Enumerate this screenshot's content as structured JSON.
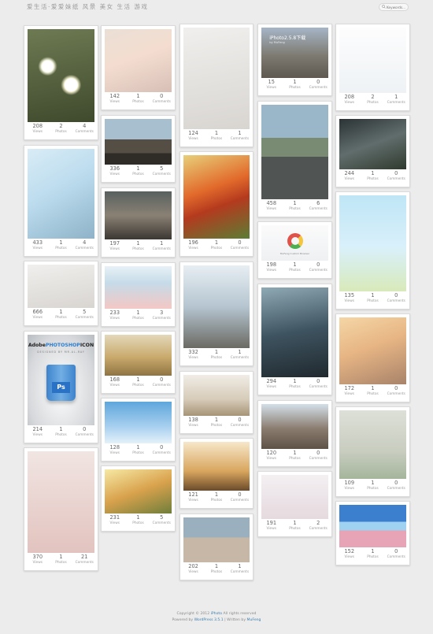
{
  "header": {
    "logo_text": "爱生活·爱爱妹纸 风景 美女 生活 游戏",
    "search_placeholder": "Keywords..."
  },
  "labels": {
    "views": "Views",
    "photos": "Photos",
    "comments": "Comments"
  },
  "cards": [
    {
      "views": "208",
      "photos": "2",
      "comments": "4"
    },
    {
      "views": "433",
      "photos": "1",
      "comments": "4"
    },
    {
      "views": "666",
      "photos": "1",
      "comments": "5"
    },
    {
      "views": "214",
      "photos": "1",
      "comments": "0"
    },
    {
      "views": "370",
      "photos": "1",
      "comments": "21"
    },
    {
      "views": "142",
      "photos": "1",
      "comments": "0"
    },
    {
      "views": "336",
      "photos": "1",
      "comments": "5"
    },
    {
      "views": "197",
      "photos": "1",
      "comments": "1"
    },
    {
      "views": "233",
      "photos": "1",
      "comments": "3"
    },
    {
      "views": "168",
      "photos": "1",
      "comments": "0"
    },
    {
      "views": "128",
      "photos": "1",
      "comments": "0"
    },
    {
      "views": "231",
      "photos": "1",
      "comments": "5"
    },
    {
      "views": "124",
      "photos": "1",
      "comments": "1"
    },
    {
      "views": "196",
      "photos": "1",
      "comments": "0"
    },
    {
      "views": "332",
      "photos": "1",
      "comments": "1"
    },
    {
      "views": "138",
      "photos": "1",
      "comments": "0"
    },
    {
      "views": "121",
      "photos": "1",
      "comments": "0"
    },
    {
      "views": "202",
      "photos": "1",
      "comments": "1"
    },
    {
      "views": "15",
      "photos": "1",
      "comments": "0"
    },
    {
      "views": "458",
      "photos": "1",
      "comments": "6"
    },
    {
      "views": "198",
      "photos": "1",
      "comments": "0"
    },
    {
      "views": "294",
      "photos": "1",
      "comments": "0"
    },
    {
      "views": "120",
      "photos": "1",
      "comments": "0"
    },
    {
      "views": "191",
      "photos": "1",
      "comments": "2"
    },
    {
      "views": "208",
      "photos": "2",
      "comments": "1"
    },
    {
      "views": "244",
      "photos": "1",
      "comments": "0"
    },
    {
      "views": "135",
      "photos": "1",
      "comments": "0"
    },
    {
      "views": "172",
      "photos": "1",
      "comments": "0"
    },
    {
      "views": "109",
      "photos": "1",
      "comments": "0"
    },
    {
      "views": "152",
      "photos": "1",
      "comments": "0"
    }
  ],
  "overlays": {
    "iphoto_title": "iPhoto2.5.8下载",
    "iphoto_sub": "by MuFeng",
    "ps_brand_a": "Adobe",
    "ps_brand_b": "PHOTOSHOP",
    "ps_brand_c": "ICON",
    "ps_sub": "DESIGNED BY MR.AL-RAY",
    "ps_can": "Ps",
    "web_caption": "MuFeng Custom Browser"
  },
  "footer": {
    "line1_prefix": "Copyright © 2012",
    "line1_link": "iPhoto",
    "line1_suffix": "All rights reserved",
    "line2_prefix": "Powered by",
    "line2_link": "WordPress 3.5.1",
    "line2_mid": "| Written by",
    "line2_author": "MuFeng"
  }
}
